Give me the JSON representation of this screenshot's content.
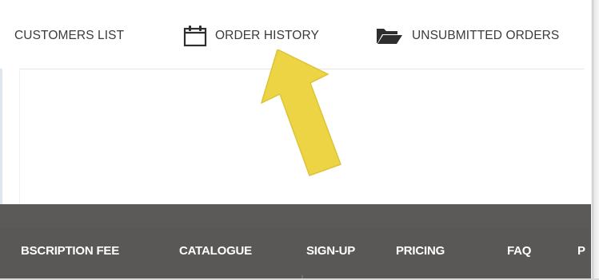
{
  "top_nav": {
    "items": [
      {
        "label": "CUSTOMERS LIST",
        "icon": "none"
      },
      {
        "label": "ORDER HISTORY",
        "icon": "calendar-icon"
      },
      {
        "label": "UNSUBMITTED ORDERS",
        "icon": "folder-open-icon"
      }
    ]
  },
  "annotation": {
    "arrow_color": "#ecd444",
    "arrow_outline": "#d9c232",
    "target": "ORDER HISTORY"
  },
  "footer_menu": {
    "background": "#5b5957",
    "items": [
      {
        "label": "BSCRIPTION FEE"
      },
      {
        "label": "CATALOGUE"
      },
      {
        "label": "SIGN-UP"
      },
      {
        "label": "PRICING"
      },
      {
        "label": "FAQ"
      },
      {
        "label": "P"
      }
    ]
  },
  "colors": {
    "nav_text": "#3b3b3b",
    "menu_text": "#ffffff"
  }
}
